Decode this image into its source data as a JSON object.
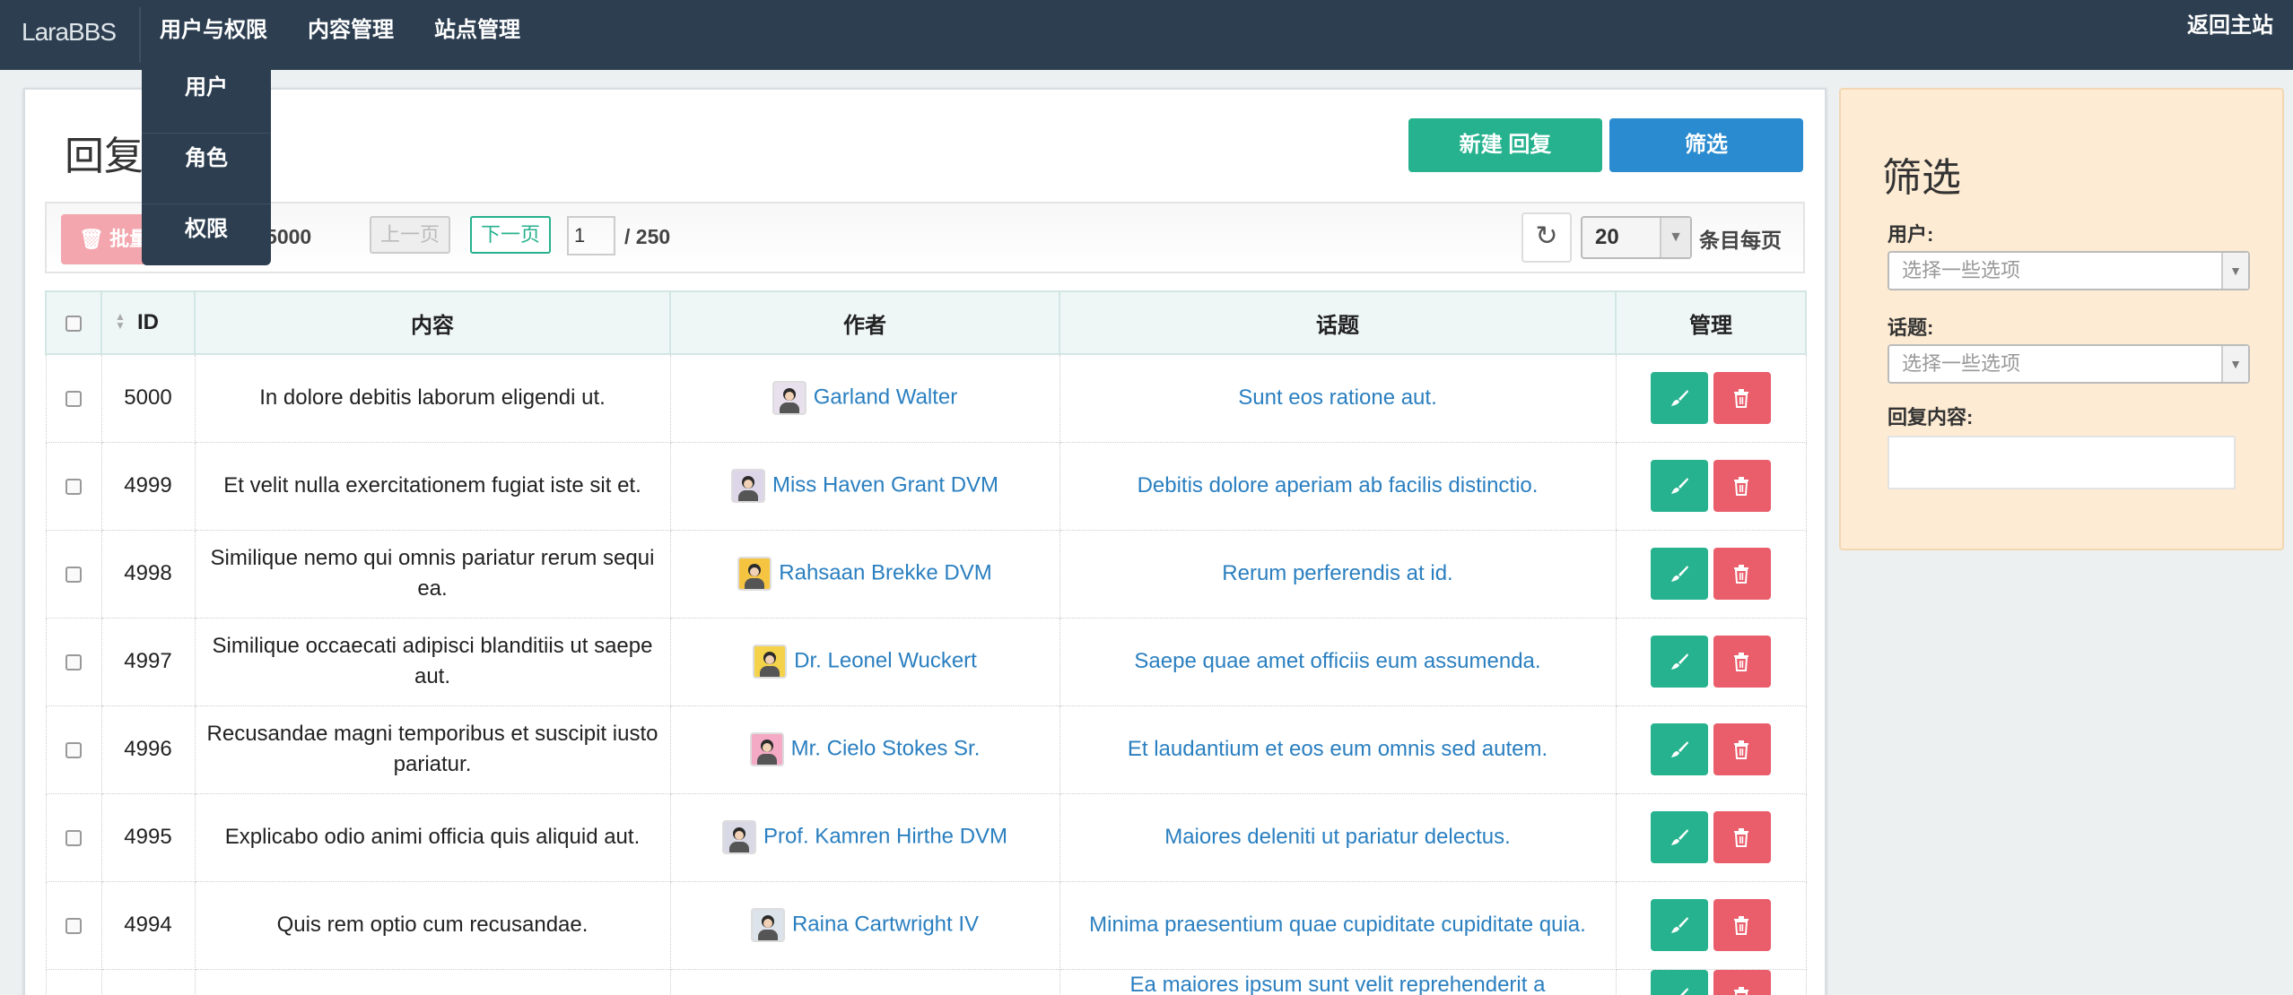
{
  "nav": {
    "brand": "LaraBBS",
    "items": [
      "用户与权限",
      "内容管理",
      "站点管理"
    ],
    "back": "返回主站"
  },
  "dropdown": {
    "items": [
      "用户",
      "角色",
      "权限"
    ]
  },
  "page": {
    "title": "回复",
    "new_button": "新建 回复",
    "filter_button": "筛选"
  },
  "toolbar": {
    "batch_label": "批量",
    "total_label": ": 5000",
    "prev": "上一页",
    "next": "下一页",
    "page_input": "1",
    "page_total": "/ 250",
    "per_page_value": "20",
    "per_page_label": "条目每页"
  },
  "table": {
    "headers": [
      "ID",
      "内容",
      "作者",
      "话题",
      "管理"
    ],
    "rows": [
      {
        "id": "5000",
        "content": "In dolore debitis laborum eligendi ut.",
        "author": "Garland Walter",
        "topic": "Sunt eos ratione aut."
      },
      {
        "id": "4999",
        "content": "Et velit nulla exercitationem fugiat iste sit et.",
        "author": "Miss Haven Grant DVM",
        "topic": "Debitis dolore aperiam ab facilis distinctio."
      },
      {
        "id": "4998",
        "content": "Similique nemo qui omnis pariatur rerum sequi ea.",
        "author": "Rahsaan Brekke DVM",
        "topic": "Rerum perferendis at id."
      },
      {
        "id": "4997",
        "content": "Similique occaecati adipisci blanditiis ut saepe aut.",
        "author": "Dr. Leonel Wuckert",
        "topic": "Saepe quae amet officiis eum assumenda."
      },
      {
        "id": "4996",
        "content": "Recusandae magni temporibus et suscipit iusto pariatur.",
        "author": "Mr. Cielo Stokes Sr.",
        "topic": "Et laudantium et eos eum omnis sed autem."
      },
      {
        "id": "4995",
        "content": "Explicabo odio animi officia quis aliquid aut.",
        "author": "Prof. Kamren Hirthe DVM",
        "topic": "Maiores deleniti ut pariatur delectus."
      },
      {
        "id": "4994",
        "content": "Quis rem optio cum recusandae.",
        "author": "Raina Cartwright IV",
        "topic": "Minima praesentium quae cupiditate cupiditate quia."
      },
      {
        "id": "",
        "content": "",
        "author": "",
        "topic": "Ea maiores ipsum sunt velit reprehenderit a"
      }
    ]
  },
  "filter": {
    "title": "筛选",
    "user_label": "用户:",
    "user_placeholder": "选择一些选项",
    "topic_label": "话题:",
    "topic_placeholder": "选择一些选项",
    "content_label": "回复内容:"
  },
  "colors": {
    "nav_bg": "#2c3e50",
    "accent_green": "#26b28e",
    "accent_blue": "#2a8bd0",
    "danger": "#ea5d6b",
    "link": "#2a7fc0",
    "filter_bg": "#fdebd3"
  },
  "icons": {
    "batch": "trash-icon",
    "refresh": "refresh-icon",
    "edit": "brush-icon",
    "delete": "trash-icon"
  }
}
